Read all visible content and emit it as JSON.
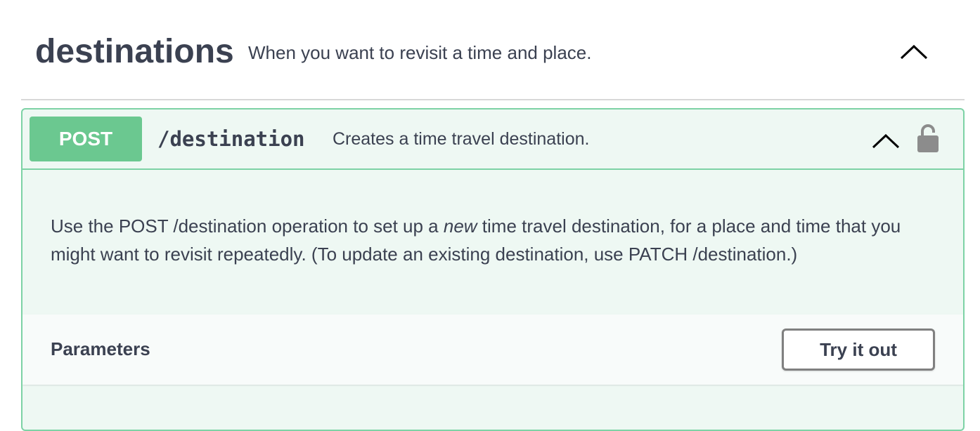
{
  "tag": {
    "name": "destinations",
    "description": "When you want to revisit a time and place."
  },
  "operation": {
    "method": "POST",
    "path": "/destination",
    "summary": "Creates a time travel destination.",
    "description": {
      "before_em": "Use the POST /destination operation to set up a ",
      "em": "new",
      "after_em": " time travel destination, for a place and time that you might want to revisit repeatedly. (To update an existing destination, use PATCH /destination.)"
    },
    "method_color": "#6bc890",
    "border_color": "#7dd2a5",
    "background_color": "#eef8f3"
  },
  "parameters": {
    "title": "Parameters",
    "try_button_label": "Try it out"
  },
  "icons": {
    "tag_toggle": "chevron-up-icon",
    "operation_toggle": "chevron-up-icon",
    "authorization": "lock-icon"
  }
}
